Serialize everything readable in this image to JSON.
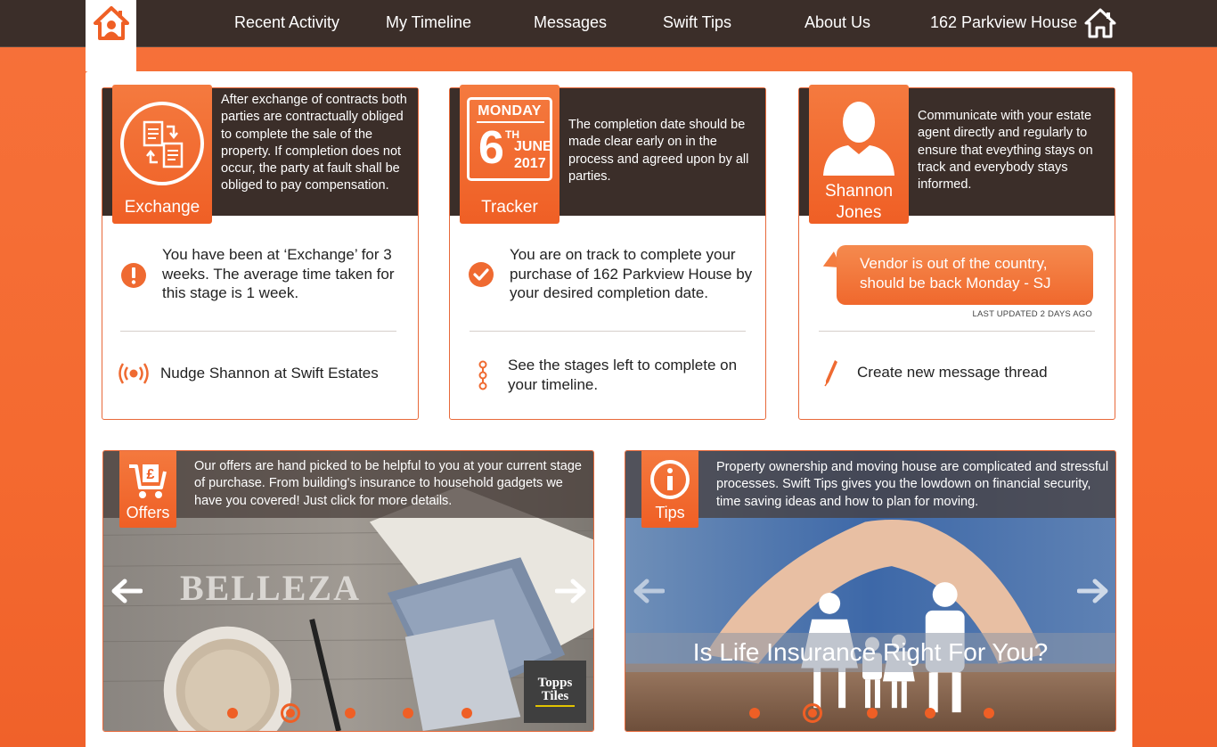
{
  "nav": {
    "items": [
      {
        "label": "Recent Activity"
      },
      {
        "label": "My Timeline"
      },
      {
        "label": "Messages"
      },
      {
        "label": "Swift Tips"
      },
      {
        "label": "About Us"
      },
      {
        "label": "162 Parkview House"
      }
    ],
    "logo_icon": "home-logo-icon",
    "property_icon": "house-icon"
  },
  "cards": {
    "exchange": {
      "badge_label": "Exchange",
      "header_text": "After exchange of contracts both parties are contractually obliged to complete the sale of the property. If completion does not occur, the party at fault shall be obliged to pay compensation.",
      "status_text": "You have been at ‘Exchange’ for 3 weeks. The average time taken for this stage is 1 week.",
      "status_icon": "alert-icon",
      "action_text": "Nudge Shannon at Swift Estates",
      "action_icon": "broadcast-icon"
    },
    "tracker": {
      "badge_label": "Tracker",
      "calendar": {
        "day": "MONDAY",
        "date": "6",
        "suffix": "TH",
        "month": "JUNE",
        "year": "2017"
      },
      "header_text": "The completion date should be made clear early on in the process and agreed upon by all parties.",
      "status_text": "You are on track to complete your purchase of 162 Parkview House by your desired completion date.",
      "status_icon": "check-icon",
      "action_text": "See the stages left to complete on your timeline.",
      "action_icon": "timeline-icon"
    },
    "agent": {
      "badge_label_line1": "Shannon",
      "badge_label_line2": "Jones",
      "header_text": "Communicate with your estate agent directly and regularly to ensure that eveything stays on track and everybody stays informed.",
      "message_text": "Vendor is out of the country, should be back Monday - SJ",
      "last_updated": "LAST UPDATED 2 DAYS AGO",
      "action_text": "Create new message thread",
      "action_icon": "pen-icon"
    }
  },
  "offers": {
    "badge_label": "Offers",
    "badge_icon": "cart-pound-icon",
    "text": "Our offers are hand picked to be helpful to you at your current stage of purchase. From building's insurance to household gadgets we have you covered! Just click for more details.",
    "brand_line1": "Topps",
    "brand_line2": "Tiles",
    "tile_word": "BELLEZA",
    "dots": 5,
    "active_dot": 1
  },
  "tips": {
    "badge_label": "Tips",
    "badge_icon": "info-icon",
    "text": "Property ownership and moving house are complicated and stressful processes. Swift Tips gives you the lowdown on financial security, time saving ideas and how to plan for moving.",
    "headline": "Is Life Insurance Right For You?",
    "dots": 5,
    "active_dot": 1
  },
  "colors": {
    "accent": "#ef5f25",
    "dark": "#3b2e29",
    "background": "#f46a30"
  }
}
